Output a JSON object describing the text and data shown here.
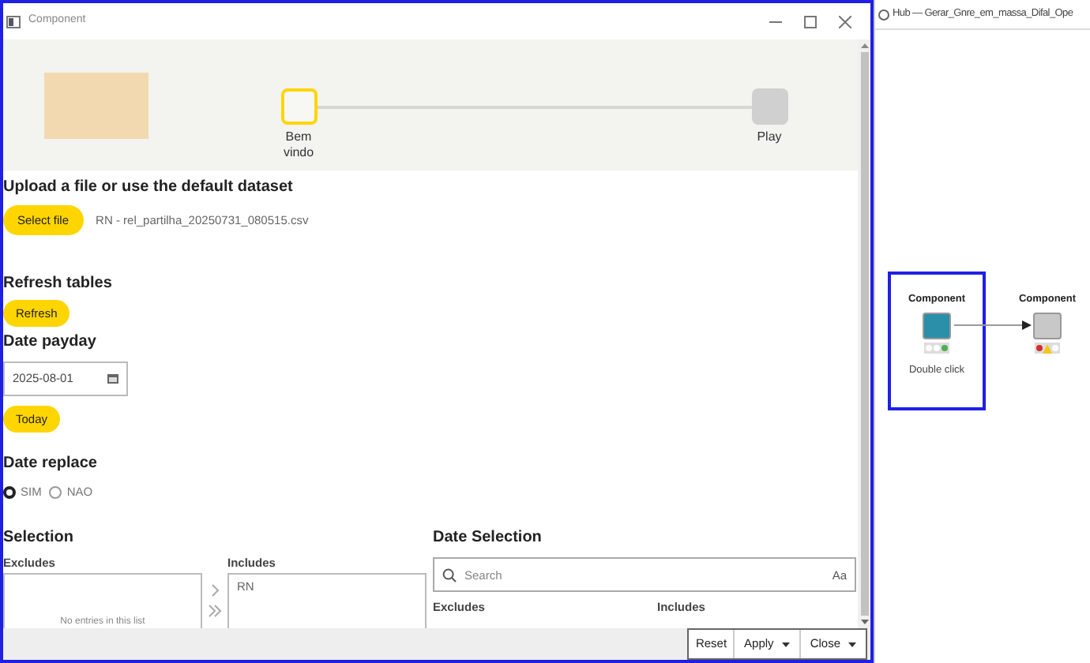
{
  "dialog": {
    "title": "Component",
    "steps": [
      {
        "label": "Bem vindo",
        "selected": true
      },
      {
        "label": "Play",
        "selected": false
      }
    ],
    "upload": {
      "heading": "Upload a file or use the default dataset",
      "button": "Select file",
      "file_name": "RN - rel_partilha_20250731_080515.csv"
    },
    "refresh": {
      "heading": "Refresh tables",
      "button": "Refresh"
    },
    "date_payday": {
      "heading": "Date payday",
      "value": "2025-08-01",
      "button": "Today"
    },
    "date_replace": {
      "heading": "Date replace",
      "options": [
        {
          "label": "SIM",
          "selected": true
        },
        {
          "label": "NAO",
          "selected": false
        }
      ]
    },
    "selection": {
      "heading": "Selection",
      "excludes_label": "Excludes",
      "includes_label": "Includes",
      "excludes_empty": "No entries in this list",
      "includes": [
        "RN"
      ]
    },
    "date_selection": {
      "heading": "Date Selection",
      "search_placeholder": "Search",
      "case_toggle": "Aa",
      "excludes_label": "Excludes",
      "includes_label": "Includes"
    },
    "footer": {
      "reset": "Reset",
      "apply": "Apply",
      "close": "Close"
    }
  },
  "workflow": {
    "title": "Hub — Gerar_Gnre_em_massa_Difal_Ope",
    "nodes": [
      {
        "label": "Component",
        "sublabel": "Double click",
        "selected": true,
        "color": "#2a8fa8"
      },
      {
        "label": "Component",
        "selected": false,
        "color": "#c8c8c8"
      }
    ]
  }
}
